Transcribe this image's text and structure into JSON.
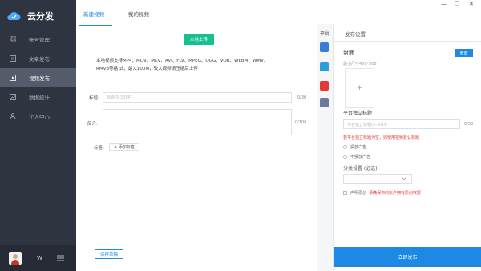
{
  "app": {
    "name": "云分发"
  },
  "sidebar": {
    "items": [
      {
        "label": "账号管理"
      },
      {
        "label": "文章发布"
      },
      {
        "label": "视频发布"
      },
      {
        "label": "数据统计"
      },
      {
        "label": "个人中心"
      }
    ],
    "active_index": 2,
    "footer": {
      "user_name": "W"
    }
  },
  "main": {
    "tabs": [
      {
        "label": "新建视频"
      },
      {
        "label": "我的视频"
      }
    ],
    "upload_button": "本地上传",
    "upload_desc_line1": "本地视频支持MP4、MOV、MKV、AVI、FLV、MPEG、OGG、VOB、WEBM、WMV、",
    "upload_desc_line2": "RMVB等格 式，最大100M，较大视频请压缩后上传",
    "title_label": "标题:",
    "title_placeholder": "标题(5-30)字",
    "title_counter": "0/30",
    "intro_label": "简介:",
    "intro_counter": "0/100",
    "tags_label": "标签:",
    "add_tag_button": "+ 添加标签",
    "save_draft_button": "保存草稿"
  },
  "platforms": {
    "title": "平台",
    "icon_names": [
      "platform-a-icon",
      "platform-b-icon",
      "platform-c-icon",
      "platform-d-icon"
    ],
    "icon_colors": [
      "#3a7bd5",
      "#2d9cdb",
      "#e53935",
      "#6b7b99"
    ]
  },
  "settings": {
    "title": "发布设置",
    "cover_title": "封面",
    "reset_button": "重置",
    "size_hint": "最小尺寸450*300",
    "cover_plus": "+",
    "platform_title_label": "平台独立标题",
    "platform_title_placeholder": "平台独立标题(5-30)字",
    "platform_title_counter": "0/30",
    "warning": "若平台独立标题为空，则使用视频默认标题",
    "ad_options": [
      "投放广告",
      "不投放广告"
    ],
    "category_label": "分类设置 (必选)",
    "declare_label": "声明原创",
    "declare_warning": "请确保你的账户拥有原创权限",
    "publish_button": "立即发布"
  },
  "colors": {
    "sidebar_bg": "#2e3440",
    "accent": "#1e88e5",
    "upload_green": "#18c08f",
    "warning_red": "#e53935"
  }
}
